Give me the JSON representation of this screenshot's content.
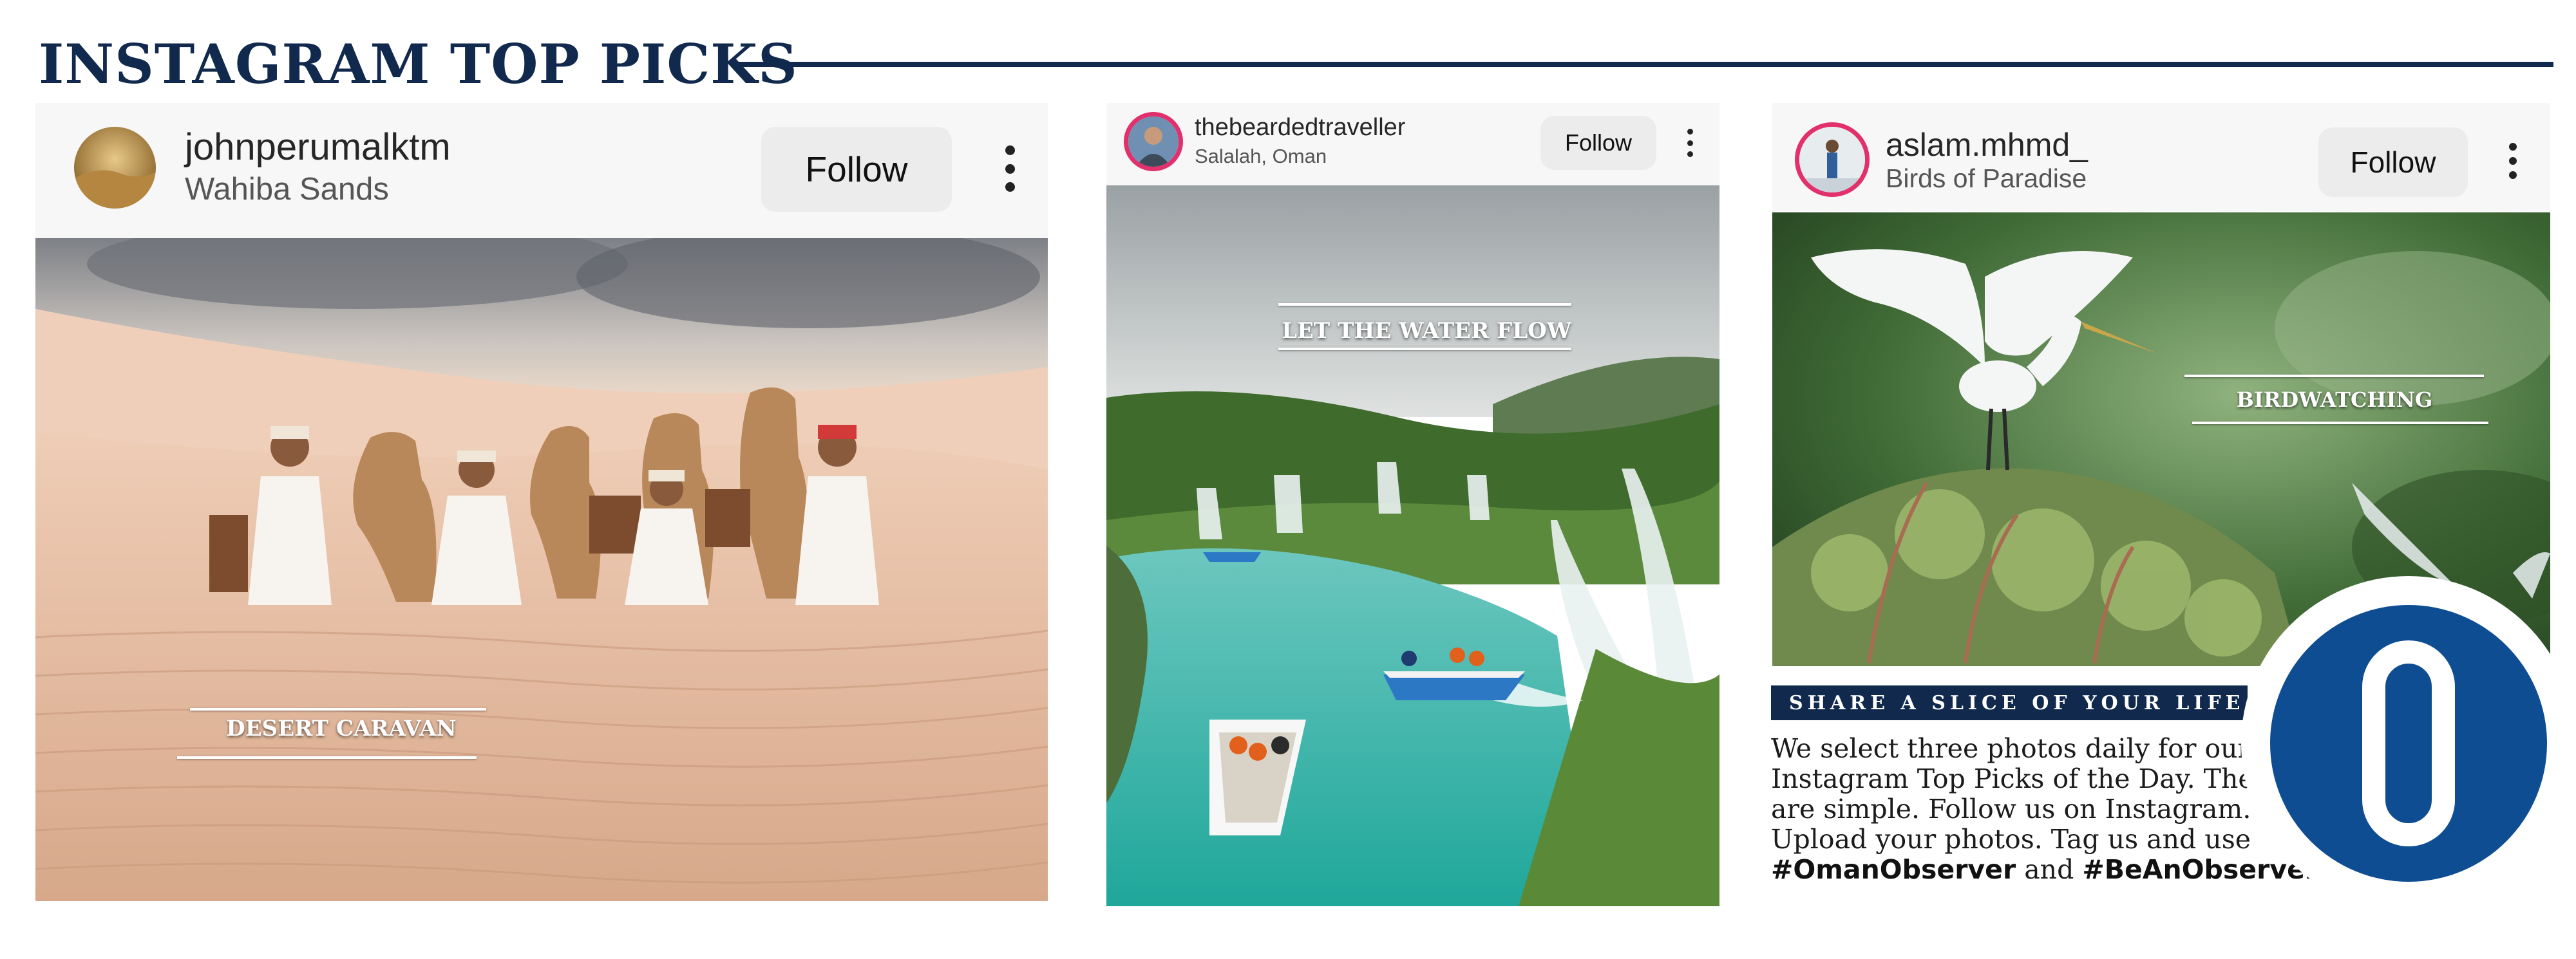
{
  "page": {
    "title": "INSTAGRAM TOP PICKS",
    "brand_navy": "#10294d",
    "logo_blue": "#0e4d92"
  },
  "posts": [
    {
      "username": "johnperumalktm",
      "location": "Wahiba Sands",
      "follow_label": "Follow",
      "caption": "DESERT CARAVAN",
      "photo_subject": "camel caravan resting on desert dunes",
      "menu_icon": "kebab-menu-icon"
    },
    {
      "username": "thebeardedtraveller",
      "location": "Salalah, Oman",
      "follow_label": "Follow",
      "caption": "LET THE WATER FLOW",
      "photo_subject": "waterfalls and boats on turquoise lagoon",
      "menu_icon": "kebab-menu-icon"
    },
    {
      "username": "aslam.mhmd_",
      "location": "Birds of Paradise",
      "follow_label": "Follow",
      "caption": "BIRDWATCHING",
      "photo_subject": "white egret taking flight over bushes",
      "menu_icon": "kebab-menu-icon"
    }
  ],
  "share": {
    "heading": "SHARE A SLICE OF YOUR LIFE",
    "body_text": "We select three photos daily for our Instagram Top Picks of the Day. The rules are simple. Follow us on Instagram. Upload your photos. Tag us and use",
    "hashtag1": "#OmanObserver",
    "connector": "and",
    "hashtag2": "#BeAnObserver."
  }
}
